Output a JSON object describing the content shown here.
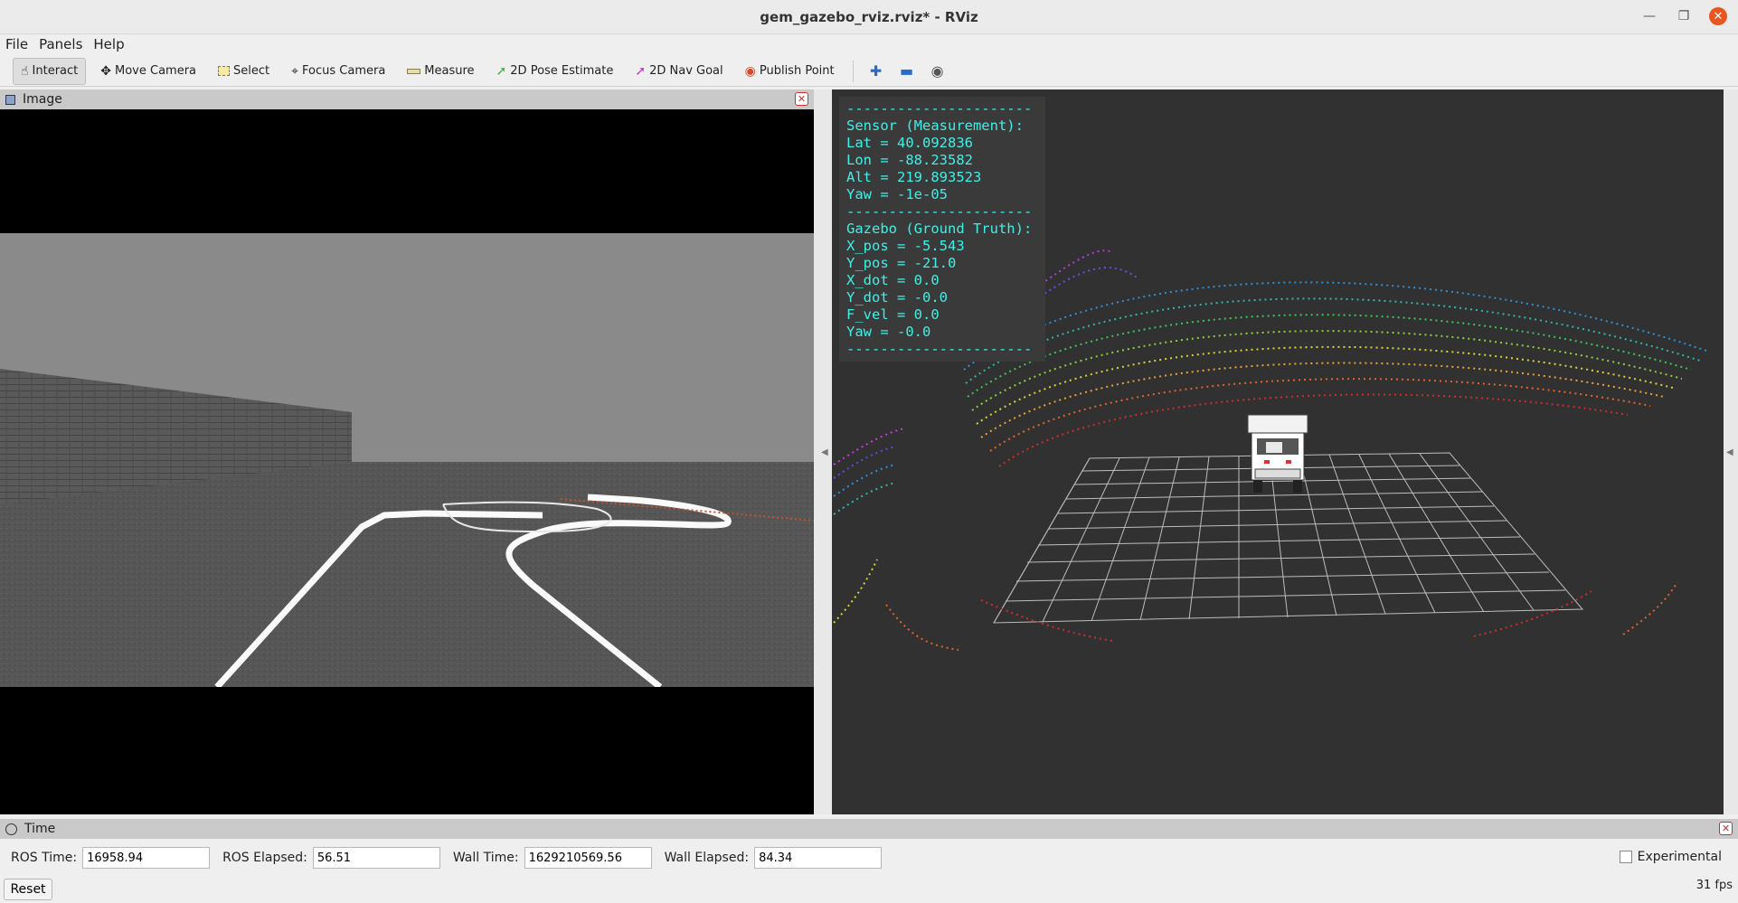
{
  "window": {
    "title": "gem_gazebo_rviz.rviz* - RViz"
  },
  "menu": [
    "File",
    "Panels",
    "Help"
  ],
  "toolbar": {
    "interact": "Interact",
    "move_camera": "Move Camera",
    "select": "Select",
    "focus_camera": "Focus Camera",
    "measure": "Measure",
    "pose_estimate": "2D Pose Estimate",
    "nav_goal": "2D Nav Goal",
    "publish_point": "Publish Point"
  },
  "image_panel": {
    "title": "Image"
  },
  "overlay": {
    "lines": [
      "----------------------",
      "Sensor (Measurement):",
      "Lat = 40.092836",
      "Lon = -88.23582",
      "Alt = 219.893523",
      "Yaw = -1e-05",
      "----------------------",
      "Gazebo (Ground Truth):",
      "X_pos = -5.543",
      "Y_pos = -21.0",
      "X_dot = 0.0",
      "Y_dot = -0.0",
      "F_vel = 0.0",
      "Yaw = -0.0",
      "----------------------"
    ]
  },
  "time_panel": {
    "title": "Time",
    "ros_time_label": "ROS Time:",
    "ros_time": "16958.94",
    "ros_elapsed_label": "ROS Elapsed:",
    "ros_elapsed": "56.51",
    "wall_time_label": "Wall Time:",
    "wall_time": "1629210569.56",
    "wall_elapsed_label": "Wall Elapsed:",
    "wall_elapsed": "84.34",
    "experimental": "Experimental",
    "reset": "Reset",
    "fps": "31 fps"
  },
  "colors": {
    "overlay_text": "#3ff0e6",
    "view_bg": "#313131",
    "grid": "#bdbdbd"
  }
}
